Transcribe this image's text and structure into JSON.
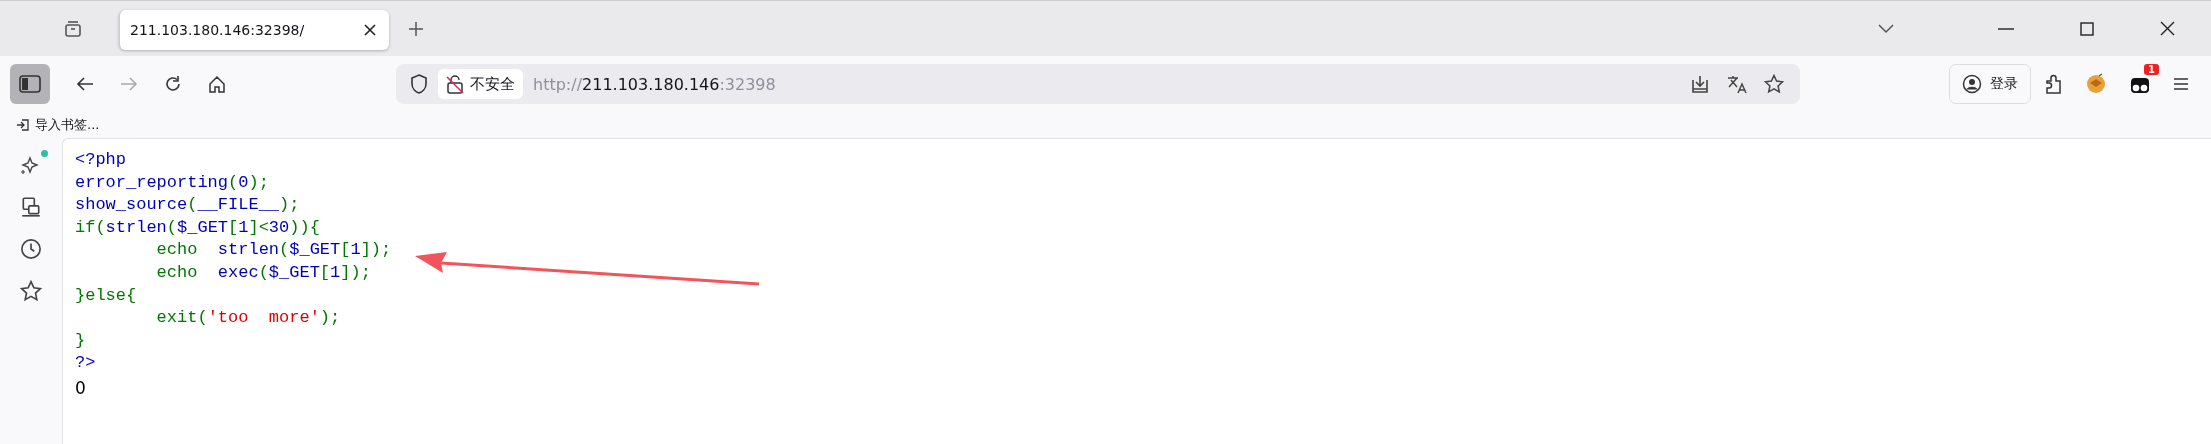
{
  "tabs": [
    {
      "title": "211.103.180.146:32398/",
      "selected": true
    }
  ],
  "toolbar": {
    "security_label": "不安全",
    "url_scheme": "http://",
    "url_host": "211.103.180.146",
    "url_port": ":32398",
    "login_label": "登录",
    "notification_badge": "1"
  },
  "bookmarks": [
    {
      "label": "导入书签..."
    }
  ],
  "sidebar": {
    "assistant_dot": true
  },
  "code_lines": [
    {
      "segments": [
        {
          "text": "<?php",
          "color": "#0000bb"
        }
      ]
    },
    {
      "segments": [
        {
          "text": "error_reporting",
          "color": "#0000bb"
        },
        {
          "text": "(",
          "color": "#007700"
        },
        {
          "text": "0",
          "color": "#0000bb"
        },
        {
          "text": ");",
          "color": "#007700"
        }
      ]
    },
    {
      "segments": [
        {
          "text": "show_source",
          "color": "#0000bb"
        },
        {
          "text": "(",
          "color": "#007700"
        },
        {
          "text": "__FILE__",
          "color": "#0000bb"
        },
        {
          "text": ");",
          "color": "#007700"
        }
      ]
    },
    {
      "segments": [
        {
          "text": "if(",
          "color": "#007700"
        },
        {
          "text": "strlen",
          "color": "#0000bb"
        },
        {
          "text": "(",
          "color": "#007700"
        },
        {
          "text": "$_GET",
          "color": "#0000bb"
        },
        {
          "text": "[",
          "color": "#007700"
        },
        {
          "text": "1",
          "color": "#0000bb"
        },
        {
          "text": "]<",
          "color": "#007700"
        },
        {
          "text": "30",
          "color": "#0000bb"
        },
        {
          "text": ")){",
          "color": "#007700"
        }
      ]
    },
    {
      "segments": [
        {
          "text": "        echo  ",
          "color": "#007700"
        },
        {
          "text": "strlen",
          "color": "#0000bb"
        },
        {
          "text": "(",
          "color": "#007700"
        },
        {
          "text": "$_GET",
          "color": "#0000bb"
        },
        {
          "text": "[",
          "color": "#007700"
        },
        {
          "text": "1",
          "color": "#0000bb"
        },
        {
          "text": "]);",
          "color": "#007700"
        }
      ]
    },
    {
      "segments": [
        {
          "text": "        echo  ",
          "color": "#007700"
        },
        {
          "text": "exec",
          "color": "#0000bb"
        },
        {
          "text": "(",
          "color": "#007700"
        },
        {
          "text": "$_GET",
          "color": "#0000bb"
        },
        {
          "text": "[",
          "color": "#007700"
        },
        {
          "text": "1",
          "color": "#0000bb"
        },
        {
          "text": "]);",
          "color": "#007700"
        }
      ]
    },
    {
      "segments": [
        {
          "text": "}else{",
          "color": "#007700"
        }
      ]
    },
    {
      "segments": [
        {
          "text": "        exit(",
          "color": "#007700"
        },
        {
          "text": "'too  more'",
          "color": "#dd0000"
        },
        {
          "text": ");",
          "color": "#007700"
        }
      ]
    },
    {
      "segments": [
        {
          "text": "}",
          "color": "#007700"
        }
      ]
    },
    {
      "segments": [
        {
          "text": "?>",
          "color": "#0000bb"
        }
      ]
    }
  ],
  "output": "0"
}
